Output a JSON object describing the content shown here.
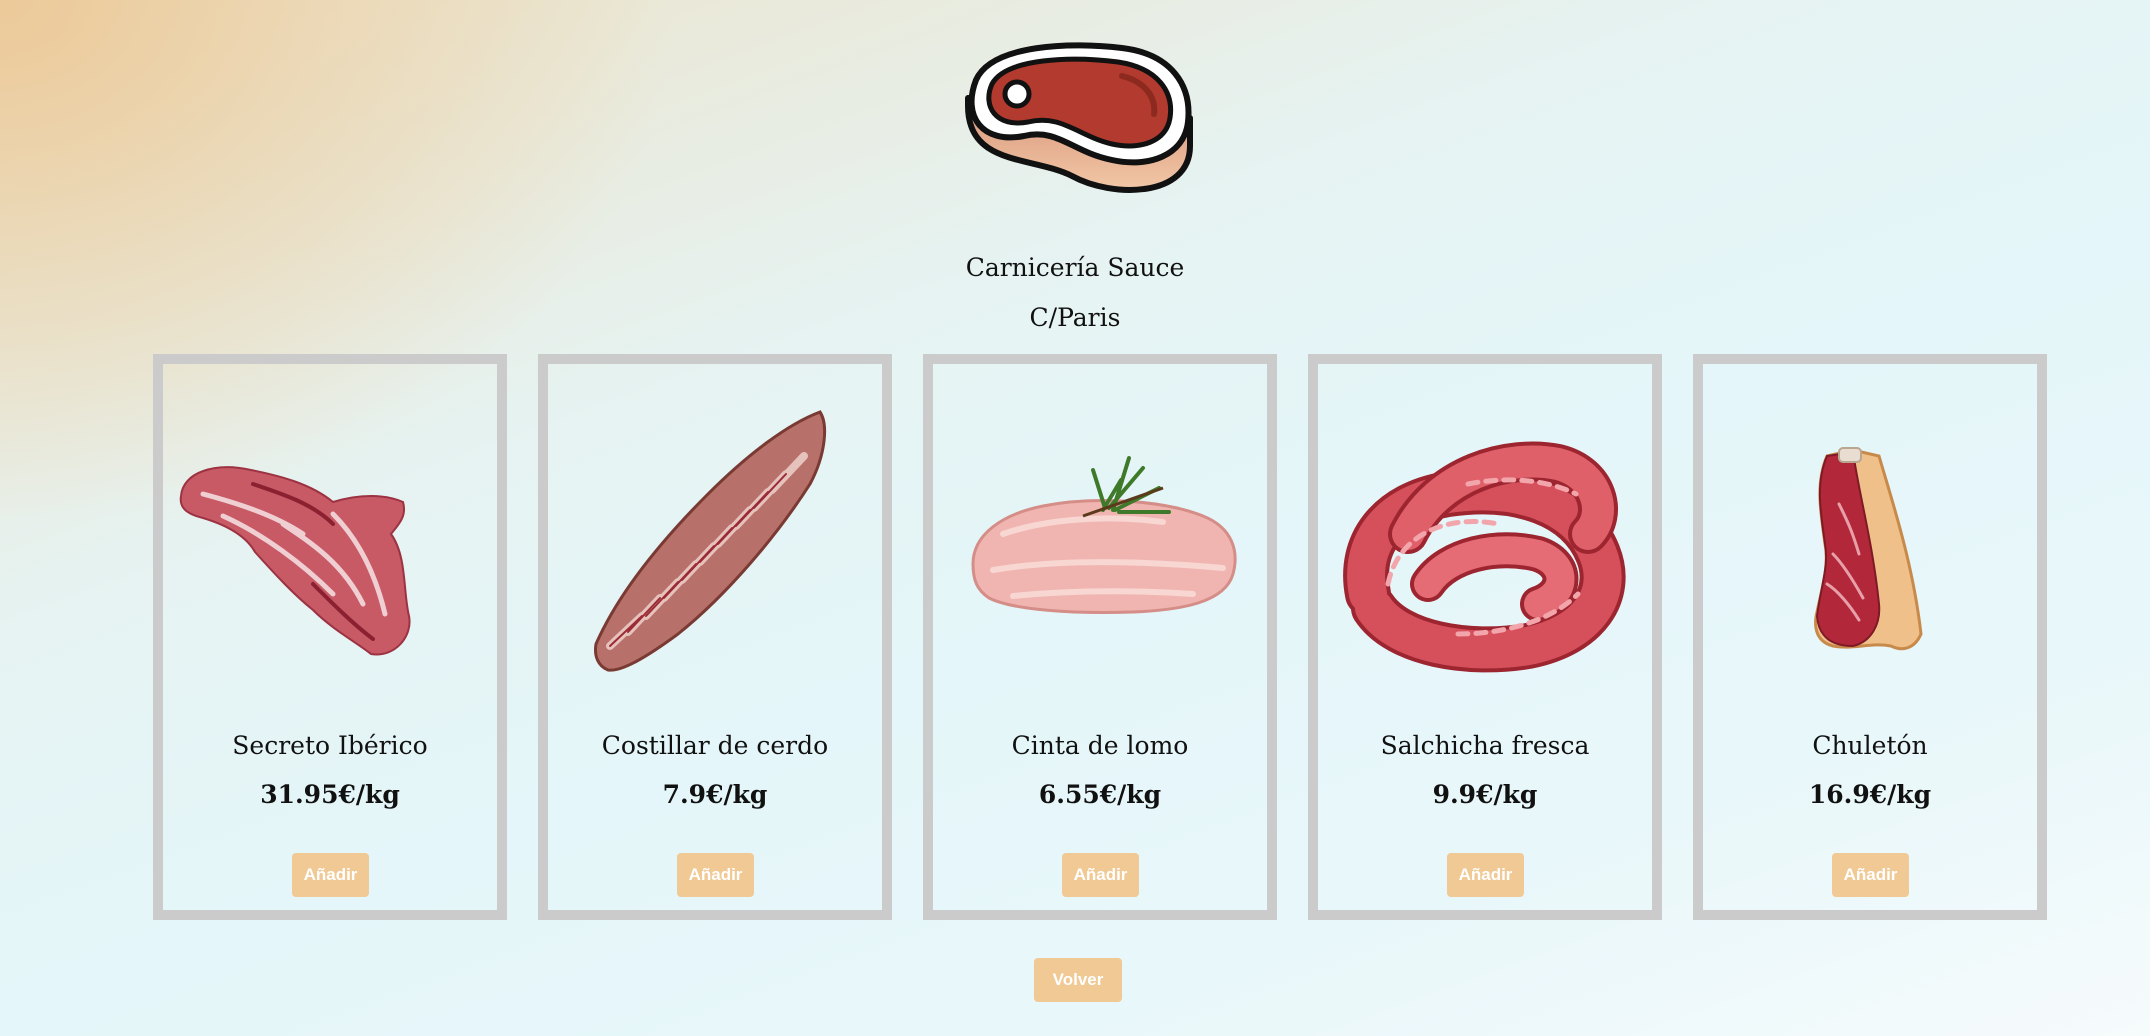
{
  "shop": {
    "logo_icon": "steak-icon",
    "name": "Carnicería Sauce",
    "address": "C/Paris"
  },
  "products": [
    {
      "name": "Secreto Ibérico",
      "price": "31.95€/kg",
      "button": "Añadir",
      "image_icon": "secreto-iberico-image"
    },
    {
      "name": "Costillar de cerdo",
      "price": "7.9€/kg",
      "button": "Añadir",
      "image_icon": "pork-ribs-image"
    },
    {
      "name": "Cinta de lomo",
      "price": "6.55€/kg",
      "button": "Añadir",
      "image_icon": "pork-loin-image"
    },
    {
      "name": "Salchicha fresca",
      "price": "9.9€/kg",
      "button": "Añadir",
      "image_icon": "fresh-sausage-image"
    },
    {
      "name": "Chuletón",
      "price": "16.9€/kg",
      "button": "Añadir",
      "image_icon": "ribeye-steak-image"
    }
  ],
  "back_button": "Volver",
  "colors": {
    "button_bg": "#f0c994",
    "button_text": "#ffffff",
    "card_border": "#cbcbcb",
    "meat_red": "#b23a2e"
  }
}
